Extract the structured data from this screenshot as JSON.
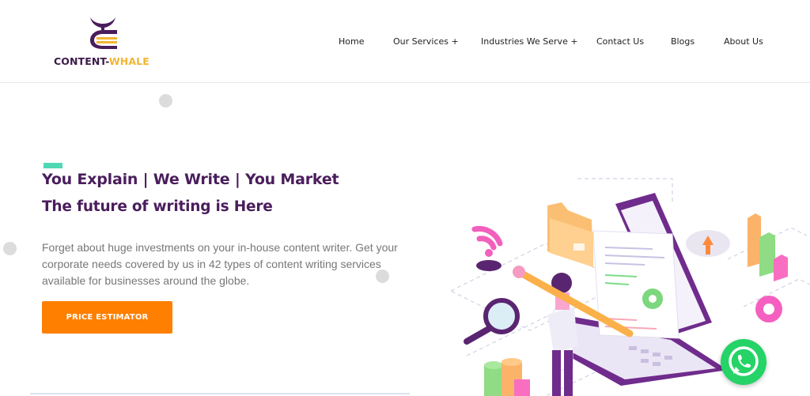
{
  "brand": {
    "name_part1": "CONTENT-",
    "name_part2": "WHALE",
    "colors": {
      "primary": "#4a1d5c",
      "accent": "#f2b531",
      "button": "#ff7f00",
      "teal": "#4fd8b3"
    }
  },
  "nav": {
    "items": [
      {
        "label": "Home"
      },
      {
        "label": "Our Services +"
      },
      {
        "label": "Industries We Serve +"
      },
      {
        "label": "Contact Us"
      },
      {
        "label": "Blogs"
      },
      {
        "label": "About Us"
      }
    ]
  },
  "hero": {
    "headline": "You Explain | We Write | You Market",
    "subheadline": "The future of writing is Here",
    "description": "Forget about huge investments on your in-house content writer. Get your corporate needs covered by us in 42 types of content writing services available for businesses around the globe.",
    "cta_label": "PRICE ESTIMATOR"
  },
  "icons": {
    "logo": "whale-tail-book-icon",
    "illustration": "laptop-writer-illustration",
    "chat": "whatsapp-icon"
  }
}
